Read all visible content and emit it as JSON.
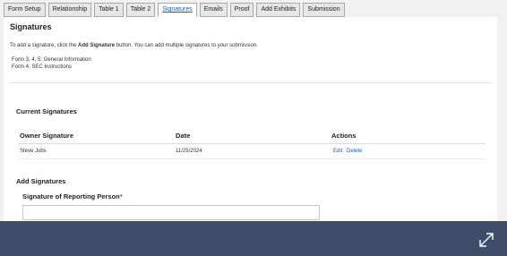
{
  "tabs": [
    {
      "label": "Form Setup"
    },
    {
      "label": "Relationship"
    },
    {
      "label": "Table 1"
    },
    {
      "label": "Table 2"
    },
    {
      "label": "Signatures"
    },
    {
      "label": "Emails"
    },
    {
      "label": "Proof"
    },
    {
      "label": "Add Exhibits"
    },
    {
      "label": "Submission"
    }
  ],
  "active_tab": "Signatures",
  "page": {
    "title": "Signatures",
    "instruction_prefix": "To add a signature, click the ",
    "instruction_bold": "Add Signature",
    "instruction_suffix": " button. You can add multiple signatures to your submission.",
    "forms": [
      "Form 3, 4, 5: General Information",
      "Form 4: SEC Instructions"
    ]
  },
  "current_signatures": {
    "heading": "Current Signatures",
    "columns": [
      "Owner Signature",
      "Date",
      "Actions"
    ],
    "rows": [
      {
        "owner": "Steve Jobs",
        "date": "11/25/2024",
        "edit": "Edit",
        "delete": "Delete"
      }
    ]
  },
  "add_signatures": {
    "heading": "Add Signatures",
    "field_label": "Signature of Reporting Person",
    "required_mark": "*",
    "field_value": ""
  },
  "footer": {
    "icon": "expand-icon"
  },
  "colors": {
    "accent": "#1a5fb4",
    "footer": "#3f4d6b"
  }
}
